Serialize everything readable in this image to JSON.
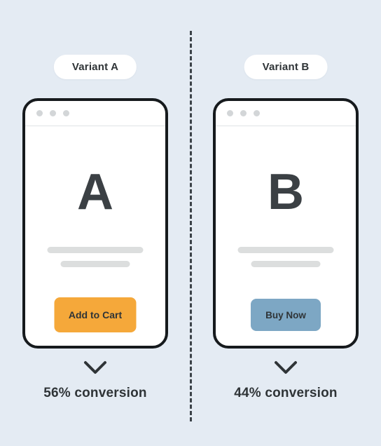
{
  "background_color": "#e4ebf3",
  "divider": {
    "style": "dashed-vertical",
    "color": "#3b4248"
  },
  "variants": [
    {
      "badge_label": "Variant A",
      "screen_letter": "A",
      "cta_label": "Add to Cart",
      "cta_color": "#f5a83a",
      "cta_text_color": "#2f3437",
      "conversion_label": "56% conversion",
      "conversion_value": 56,
      "chevron_icon": "chevron-down-icon",
      "window_dots": 3
    },
    {
      "badge_label": "Variant B",
      "screen_letter": "B",
      "cta_label": "Buy Now",
      "cta_color": "#7da7c4",
      "cta_text_color": "#2f3437",
      "conversion_label": "44% conversion",
      "conversion_value": 44,
      "chevron_icon": "chevron-down-icon",
      "window_dots": 3
    }
  ],
  "chart_data": {
    "type": "bar",
    "title": "",
    "categories": [
      "Variant A",
      "Variant B"
    ],
    "values": [
      56,
      44
    ],
    "xlabel": "",
    "ylabel": "conversion",
    "ylim": [
      0,
      100
    ],
    "unit": "%",
    "legend": []
  }
}
